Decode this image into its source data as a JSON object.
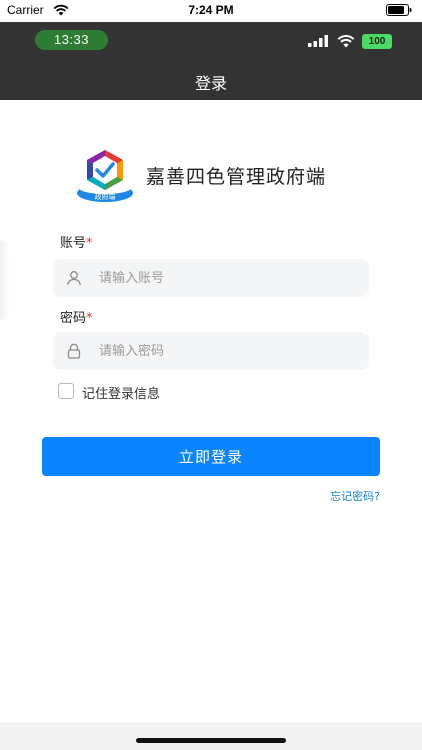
{
  "ios_status": {
    "carrier": "Carrier",
    "time": "7:24 PM"
  },
  "system_status": {
    "time": "13:33",
    "battery": "100"
  },
  "nav": {
    "title": "登录"
  },
  "header": {
    "logo_text": "政府端",
    "app_title": "嘉善四色管理政府端"
  },
  "form": {
    "account_label": "账号",
    "account_placeholder": "请输入账号",
    "password_label": "密码",
    "password_placeholder": "请输入密码",
    "required_mark": "*",
    "remember_label": "记住登录信息",
    "remember_checked": false
  },
  "actions": {
    "login_label": "立即登录",
    "forgot_label": "忘记密码?"
  },
  "colors": {
    "primary": "#0a84ff",
    "nav_bg": "#333333",
    "link": "#1a7fd8",
    "required": "#e53935",
    "time_pill": "#2e7d32"
  }
}
